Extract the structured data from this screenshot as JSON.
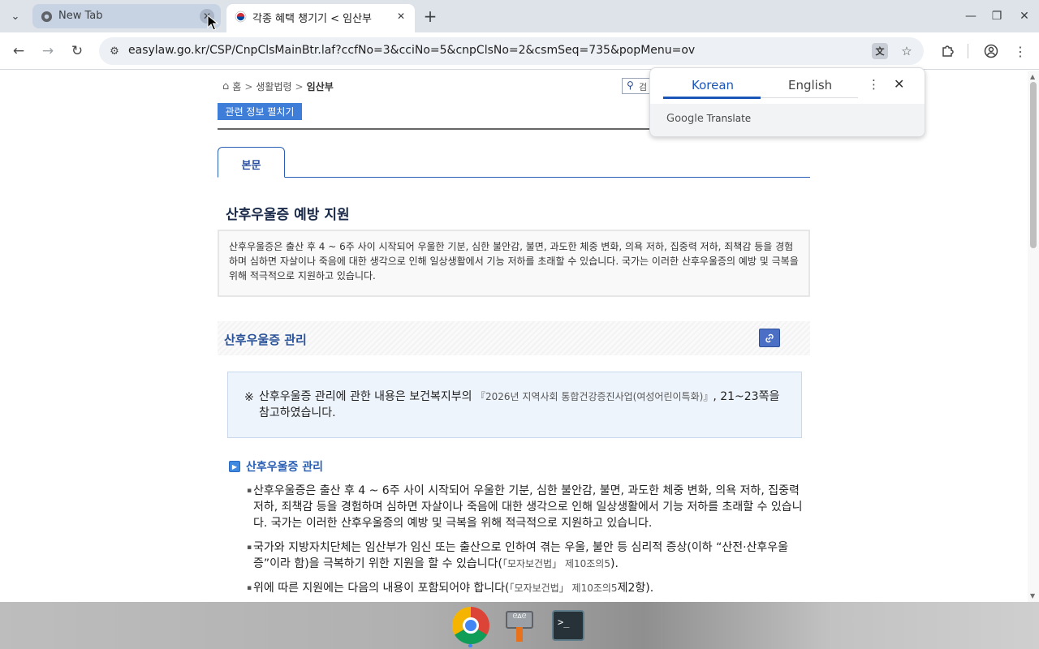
{
  "browser": {
    "tabs": [
      {
        "title": "New Tab",
        "active": false
      },
      {
        "title": "각종 혜택 챙기기 < 임산부",
        "active": true
      }
    ],
    "new_tab_symbol": "+",
    "url": "easylaw.go.kr/CSP/CnpClsMainBtr.laf?ccfNo=3&cciNo=5&cnpClsNo=2&csmSeq=735&popMenu=ov",
    "icons": {
      "back": "back-arrow-icon",
      "forward": "forward-arrow-icon",
      "reload": "reload-icon",
      "site_info": "tune-icon",
      "translate": "translate-icon",
      "bookmark": "star-icon",
      "extensions": "puzzle-icon",
      "profile": "profile-icon",
      "menu": "kebab-menu-icon"
    }
  },
  "translate_popup": {
    "source_lang": "Korean",
    "target_lang": "English",
    "brand_google": "Google",
    "brand_translate": "Translate",
    "accent": "#1a56b8"
  },
  "page": {
    "breadcrumb": {
      "home": "홈",
      "separator": ">",
      "level1": "생활법령",
      "current": "임산부"
    },
    "search_partial": "검",
    "related_info_button": "관련 정보 펼치기",
    "tab_body": "본문",
    "main_title": "산후우울증 예방 지원",
    "summary": "산후우울증은 출산 후 4 ~ 6주 사이 시작되어 우울한 기분, 심한 불안감, 불면, 과도한 체중 변화, 의욕 저하, 집중력 저하, 죄책감 등을 경험하며 심하면 자살이나 죽음에 대한 생각으로 인해 일상생활에서 기능 저하를 초래할 수 있습니다. 국가는 이러한 산후우울증의 예방 및 극복을 위해 적극적으로 지원하고 있습니다.",
    "section_title": "산후우울증 관리",
    "notice": {
      "mark": "※",
      "text_before": "산후우울증 관리에 관한 내용은 보건복지부의 ",
      "ref": "『2026년 지역사회 통합건강증진사업(여성어린이특화)』",
      "text_after": ", 21~23쪽을 참고하였습니다."
    },
    "subsection_title": "산후우울증 관리",
    "bullets": [
      {
        "text": "산후우울증은 출산 후 4 ~ 6주 사이 시작되어 우울한 기분, 심한 불안감, 불면, 과도한 체중 변화, 의욕 저하, 집중력 저하, 죄책감 등을 경험하며 심하면 자살이나 죽음에 대한 생각으로 인해 일상생활에서 기능 저하를 초래할 수 있습니다. 국가는 이러한 산후우울증의 예방 및 극복을 위해 적극적으로 지원하고 있습니다.",
        "ref": "",
        "tail": ""
      },
      {
        "text": "국가와 지방자치단체는 임산부가 임신 또는 출산으로 인하여 겪는 우울, 불안 등 심리적 증상(이하 “산전·산후우울증”이라 함)을 극복하기 위한 지원을 할 수 있습니다(",
        "ref": "「모자보건법」 제10조의5",
        "tail": ")."
      },
      {
        "text": "위에 따른 지원에는 다음의 내용이 포함되어야 합니다(",
        "ref": "「모자보건법」 제10조의5",
        "tail": "제2항)."
      }
    ]
  },
  "shelf": {
    "apps": [
      "chrome-icon",
      "text-editor-icon",
      "terminal-icon"
    ],
    "terminal_prompt": ">_"
  }
}
